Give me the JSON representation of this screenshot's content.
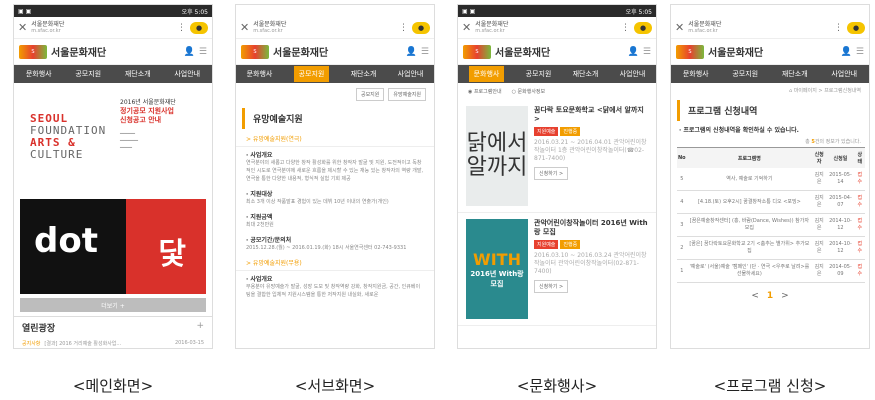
{
  "screens": [
    {
      "caption": "<메인화면>",
      "status": "오후 5:05",
      "url": "서울문화재단",
      "url_sub": "m.sfac.or.kr",
      "title": "서울문화재단",
      "nav": [
        "문화행사",
        "공모지원",
        "재단소개",
        "사업안내"
      ],
      "poster": {
        "year": "2016년 서울문화재단",
        "title1": "정기공모 지원사업",
        "title2": "신청공고 안내",
        "big1": "SEOUL",
        "big2": "FOUNDATION",
        "big3": "ARTS &",
        "big4": "CULTURE"
      },
      "dot_word": "dot",
      "dot_hj": "닻",
      "more": "더보기 +",
      "section": "열린광장",
      "plus": "+",
      "news": {
        "tag": "공지사항",
        "text": "[결과] 2016 거리예술 활성화사업...",
        "date": "2016-03-15"
      }
    },
    {
      "caption": "<서브화면>",
      "url": "서울문화재단",
      "url_sub": "m.sfac.or.kr",
      "title": "서울문화재단",
      "nav": [
        "문화행사",
        "공모지원",
        "재단소개",
        "사업안내"
      ],
      "selects": [
        "공모지원",
        "유망예술지원"
      ],
      "heading": "유망예술지원",
      "sub1": "> 유망예술지원(연극)",
      "items": [
        {
          "k": "· 사업개요",
          "v": "연극분야의 새롭고 다양한 창작 활성화를 위한 창작자 발굴 및 지원, 도전적이고 독창적인 시도로 연극분야에 새로운 흐름을 제시할 수 있는 재능 있는 창작자의 역량 개발, 연극을 통한 다양한 내용적, 형식적 실험 기회 제공"
        },
        {
          "k": "· 지원대상",
          "v": "최소 3개 이상 작품발표 경험이 있는 데뷔 10년 이내의 연출가(개인)"
        },
        {
          "k": "· 지원금액",
          "v": "최대 2천만원"
        },
        {
          "k": "· 공모기간/문의처",
          "v": "2015.12.28.(월) ~ 2016.01.19.(화) 18시 서울연극센터 02-743-9331"
        }
      ],
      "sub2": "> 유망예술지원(무용)",
      "item2": {
        "k": "· 사업개요",
        "v": "무용분야 유망예술가 발굴, 성장 도모 및 창작역량 강화, 창작지원금, 공간, 인큐베이팅을 결합한 입체적 지원시스템을 통한 저작지원 내실화, 새로운"
      }
    },
    {
      "caption": "<문화행사>",
      "status": "오후 5:05",
      "url": "서울문화재단",
      "url_sub": "m.sfac.or.kr",
      "title": "서울문화재단",
      "nav": [
        "문화행사",
        "공모지원",
        "재단소개",
        "사업안내"
      ],
      "radios": [
        "프로그램안내",
        "문화행사정보"
      ],
      "events": [
        {
          "img": "닭에서 알까지",
          "title": "꿈다락 토요문화학교 <닭에서 알까지>",
          "badges": [
            "지원예술",
            "진행중"
          ],
          "date": "2016.03.21 ~ 2016.04.01 관악어린이창작놀이터 1층 관악어린이창작놀이터(☎02-871-7400)",
          "btn": "신청하기 >"
        },
        {
          "img": "WITH",
          "img_sub": "2016년 With랑 모집",
          "title": "관악어린이창작놀이터 2016년 With랑 모집",
          "badges": [
            "지원예술",
            "진행중"
          ],
          "date": "2016.03.10 ~ 2016.03.24 관악어린이창작놀이터 관악어린이창작놀이터(02-871-7400)",
          "btn": "신청하기 >"
        }
      ]
    },
    {
      "caption": "<프로그램 신청>",
      "url": "서울문화재단",
      "url_sub": "m.sfac.or.kr",
      "title": "서울문화재단",
      "nav": [
        "문화행사",
        "공모지원",
        "재단소개",
        "사업안내"
      ],
      "bread": "마이페이지 > 프로그램신청내역",
      "heading": "프로그램 신청내역",
      "desc": "· 프로그램의 신청내역을 확인하실 수 있습니다.",
      "count_pre": "총 ",
      "count": "5",
      "count_post": "건의 정보가 있습니다.",
      "cols": [
        "No",
        "프로그램명",
        "신청자",
        "신청일",
        "상태"
      ],
      "rows": [
        [
          "5",
          "역사, 예술로 기억하기",
          "김지은",
          "2015-05-14",
          "접수"
        ],
        [
          "4",
          "[4.18.(토) 오후2시] 꿈결창작소통 디오 <포밍>",
          "김지은",
          "2015-04-07",
          "접수"
        ],
        [
          "3",
          "[꿈은예술창작센터] (홍, 바람(Dance, Wishes)) 참가자 모집",
          "김지은",
          "2014-10-12",
          "접수"
        ],
        [
          "2",
          "[꿈은] 꿈다락토요문화학교 2기 <춤추는 별가위> 추가모집",
          "김지은",
          "2014-10-12",
          "접수"
        ],
        [
          "1",
          "'예술로' (서울)예술 '캠페인' (단 · 연극 <우주로 날려>를 선물하세요)",
          "김지은",
          "2014-05-09",
          "접수"
        ]
      ],
      "page": "1",
      "prev": "<",
      "next": ">"
    }
  ]
}
